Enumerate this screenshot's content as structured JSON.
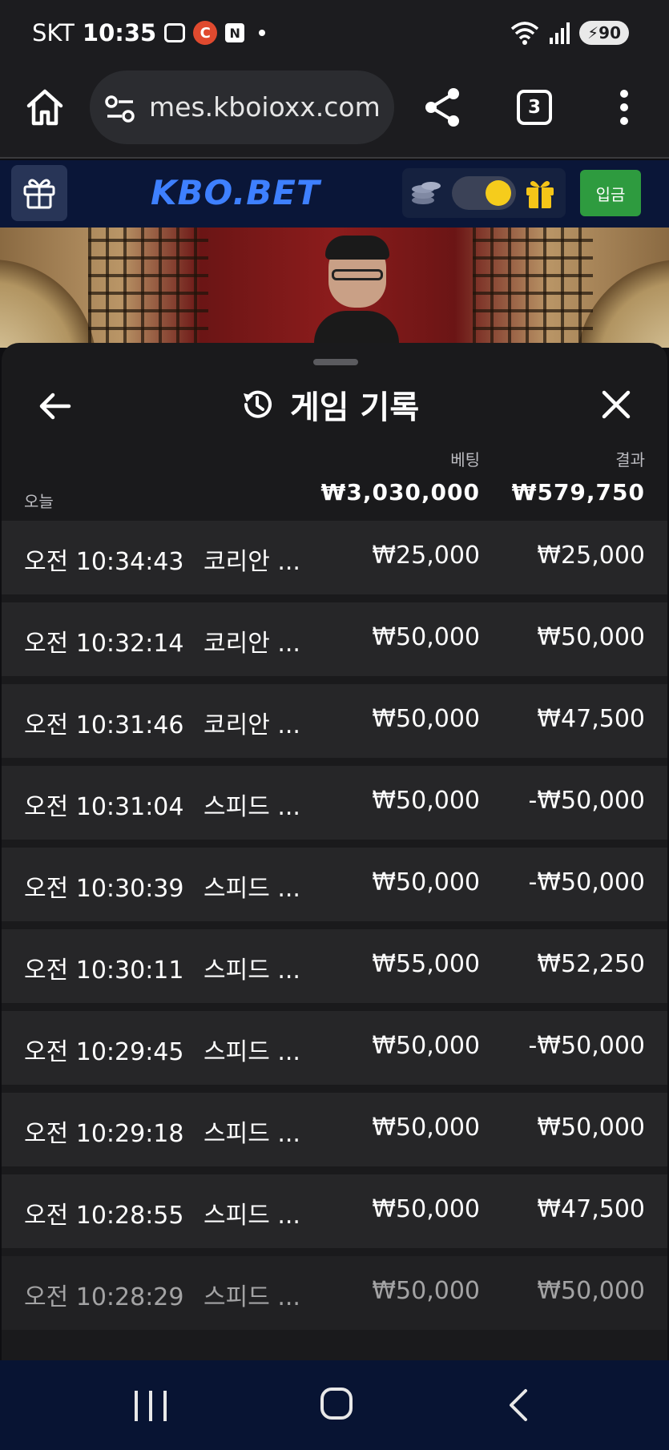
{
  "status_bar": {
    "carrier": "SKT",
    "time": "10:35",
    "notif_c": "C",
    "notif_n": "N",
    "battery": "90"
  },
  "browser": {
    "url": "mes.kboioxx.com",
    "tab_count": "3"
  },
  "site": {
    "logo": "KBO.BET",
    "deposit_label": "입금"
  },
  "panel": {
    "title": "게임 기록",
    "bet_header": "베팅",
    "result_header": "결과",
    "today_label": "오늘",
    "total_bet": "₩3,030,000",
    "total_result": "₩579,750"
  },
  "rows": [
    {
      "time": "오전 10:34:43",
      "game": "코리안 ...",
      "bet": "₩25,000",
      "result": "₩25,000"
    },
    {
      "time": "오전 10:32:14",
      "game": "코리안 ...",
      "bet": "₩50,000",
      "result": "₩50,000"
    },
    {
      "time": "오전 10:31:46",
      "game": "코리안 ...",
      "bet": "₩50,000",
      "result": "₩47,500"
    },
    {
      "time": "오전 10:31:04",
      "game": "스피드 ...",
      "bet": "₩50,000",
      "result": "-₩50,000"
    },
    {
      "time": "오전 10:30:39",
      "game": "스피드 ...",
      "bet": "₩50,000",
      "result": "-₩50,000"
    },
    {
      "time": "오전 10:30:11",
      "game": "스피드 ...",
      "bet": "₩55,000",
      "result": "₩52,250"
    },
    {
      "time": "오전 10:29:45",
      "game": "스피드 ...",
      "bet": "₩50,000",
      "result": "-₩50,000"
    },
    {
      "time": "오전 10:29:18",
      "game": "스피드 ...",
      "bet": "₩50,000",
      "result": "₩50,000"
    },
    {
      "time": "오전 10:28:55",
      "game": "스피드 ...",
      "bet": "₩50,000",
      "result": "₩47,500"
    },
    {
      "time": "오전 10:28:29",
      "game": "스피드 ...",
      "bet": "₩50,000",
      "result": "₩50,000"
    }
  ],
  "colors": {
    "logo_blue": "#3e80ff",
    "deposit_green": "#2e9b3f",
    "toggle_yellow": "#f5cc1c",
    "header_navy": "#0a1638"
  },
  "icons": [
    "screenshot-icon",
    "home-icon",
    "tune-icon",
    "share-icon",
    "more-vert-icon",
    "gift-icon",
    "coins-icon",
    "theme-toggle-icon",
    "history-icon",
    "back-arrow-icon",
    "close-icon",
    "nav-recent-icon",
    "nav-home-icon",
    "nav-back-icon"
  ]
}
